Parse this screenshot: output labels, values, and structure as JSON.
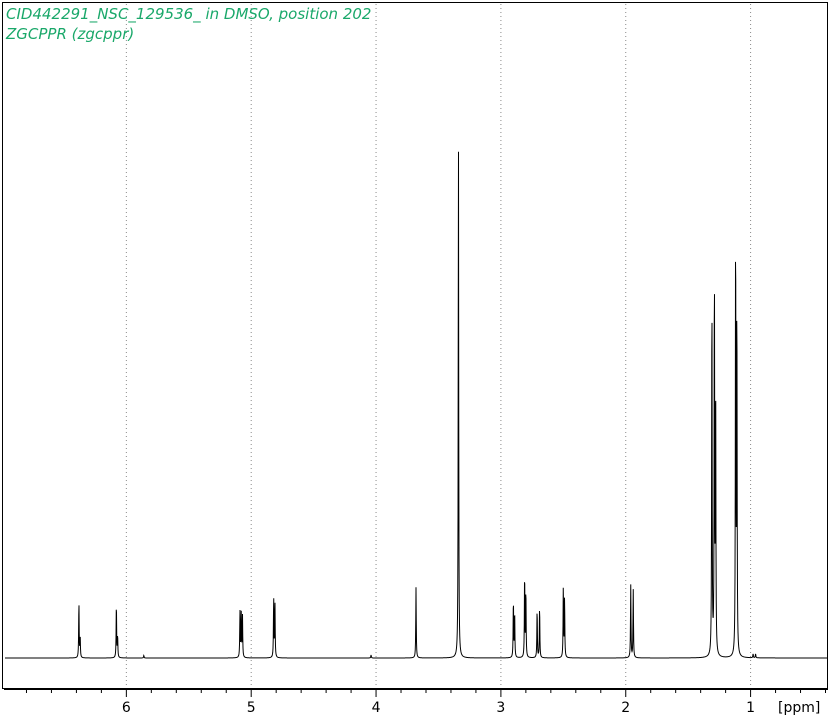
{
  "chart_data": {
    "type": "line",
    "title": "CID442291_NSC_129536_ in DMSO, position 202",
    "subtitle": "ZGCPPR (zgcppr)",
    "xlabel": "[ppm]",
    "ylabel": "",
    "x_reversed": true,
    "xlim": [
      6.98,
      0.38
    ],
    "ylim": [
      0,
      100
    ],
    "grid": "vertical dotted at major ticks",
    "major_ticks": [
      6,
      5,
      4,
      3,
      2,
      1
    ],
    "tick_labels": [
      "6",
      "5",
      "4",
      "3",
      "2",
      "1"
    ],
    "minor_tick_step": 0.2,
    "baseline_noise_level": 0,
    "series": [
      {
        "values": [],
        "peaks": [
          {
            "ppm": 6.38,
            "height": 10.9
          },
          {
            "ppm": 6.37,
            "height": 4.0
          },
          {
            "ppm": 6.08,
            "height": 10.6
          },
          {
            "ppm": 6.07,
            "height": 4.2
          },
          {
            "ppm": 5.86,
            "height": 0.5
          },
          {
            "ppm": 5.09,
            "height": 8.8
          },
          {
            "ppm": 5.08,
            "height": 8.4
          },
          {
            "ppm": 5.07,
            "height": 8.1
          },
          {
            "ppm": 4.82,
            "height": 11.7
          },
          {
            "ppm": 4.81,
            "height": 10.9
          },
          {
            "ppm": 4.04,
            "height": 0.6
          },
          {
            "ppm": 3.68,
            "height": 13.5
          },
          {
            "ppm": 3.34,
            "height": 100.0
          },
          {
            "ppm": 2.9,
            "height": 11.2
          },
          {
            "ppm": 2.89,
            "height": 9.0
          },
          {
            "ppm": 2.81,
            "height": 16.5
          },
          {
            "ppm": 2.8,
            "height": 13.2
          },
          {
            "ppm": 2.71,
            "height": 9.5
          },
          {
            "ppm": 2.69,
            "height": 10.0
          },
          {
            "ppm": 2.5,
            "height": 13.8
          },
          {
            "ppm": 2.49,
            "height": 11.5
          },
          {
            "ppm": 1.96,
            "height": 13.9
          },
          {
            "ppm": 1.94,
            "height": 13.0
          },
          {
            "ppm": 1.31,
            "height": 72.5
          },
          {
            "ppm": 1.29,
            "height": 76.6
          },
          {
            "ppm": 1.28,
            "height": 53.5
          },
          {
            "ppm": 1.12,
            "height": 85.0
          },
          {
            "ppm": 1.11,
            "height": 69.3
          },
          {
            "ppm": 0.98,
            "height": 0.8
          },
          {
            "ppm": 0.96,
            "height": 0.8
          }
        ]
      }
    ]
  }
}
